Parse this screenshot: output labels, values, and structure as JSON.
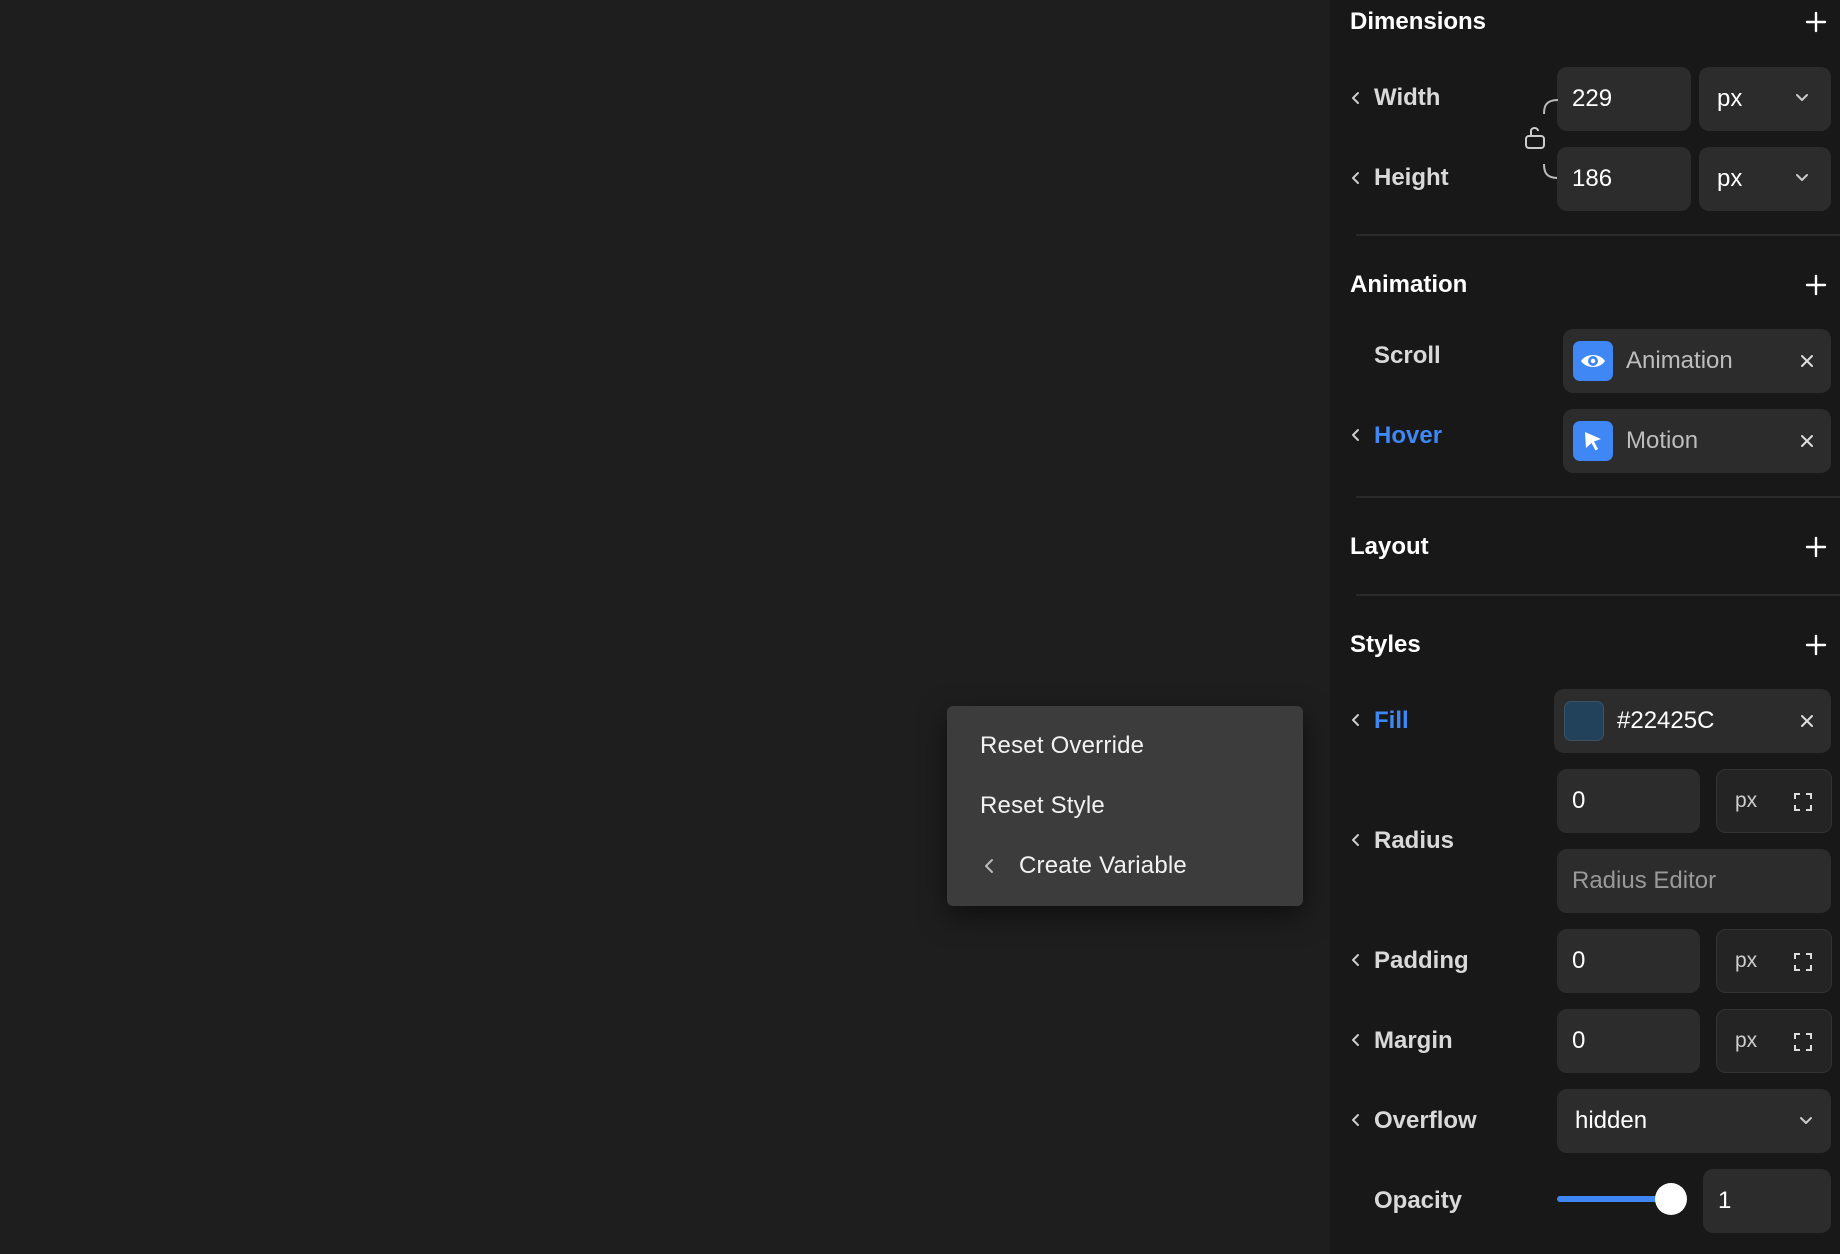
{
  "context_menu": {
    "items": [
      {
        "label": "Reset Override"
      },
      {
        "label": "Reset Style"
      },
      {
        "label": "Create Variable"
      }
    ]
  },
  "panel": {
    "dimensions": {
      "title": "Dimensions",
      "width_label": "Width",
      "width_value": "229",
      "width_unit": "px",
      "height_label": "Height",
      "height_value": "186",
      "height_unit": "px"
    },
    "animation": {
      "title": "Animation",
      "scroll_label": "Scroll",
      "scroll_chip": "Animation",
      "hover_label": "Hover",
      "hover_chip": "Motion"
    },
    "layout": {
      "title": "Layout"
    },
    "styles": {
      "title": "Styles",
      "fill_label": "Fill",
      "fill_value": "#22425C",
      "radius_label": "Radius",
      "radius_value": "0",
      "radius_unit": "px",
      "radius_editor_placeholder": "Radius Editor",
      "padding_label": "Padding",
      "padding_value": "0",
      "padding_unit": "px",
      "margin_label": "Margin",
      "margin_value": "0",
      "margin_unit": "px",
      "overflow_label": "Overflow",
      "overflow_value": "hidden",
      "opacity_label": "Opacity",
      "opacity_value": "1"
    }
  },
  "colors": {
    "background": "#1e1e1e",
    "panel": "#181818",
    "accent": "#3f87f5",
    "fill_swatch": "#22425C"
  },
  "icons": [
    "chevron-left-icon",
    "plus-icon",
    "lock-open-icon",
    "chevron-down-icon",
    "eye-icon",
    "cursor-icon",
    "close-icon",
    "expand-icon"
  ]
}
